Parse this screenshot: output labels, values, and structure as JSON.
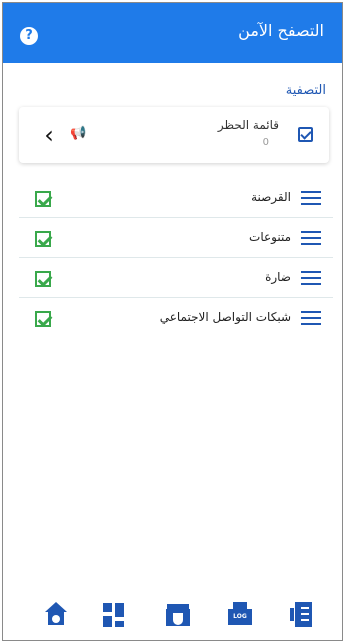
{
  "header": {
    "title": "التصفح الآمن",
    "help_icon": "help-icon"
  },
  "filtering": {
    "section_title": "التصفية",
    "blocklist": {
      "title": "قائمة الحظر",
      "count": "0",
      "checked": true,
      "icons": [
        "back-arrow-icon",
        "megaphone-icon"
      ]
    },
    "categories": [
      {
        "label": "القرصنة",
        "checked": true
      },
      {
        "label": "متنوعات",
        "checked": true
      },
      {
        "label": "ضارة",
        "checked": true
      },
      {
        "label": "شبكات التواصل الاجتماعي",
        "checked": true
      }
    ]
  },
  "bottom_nav": {
    "items": [
      "home-icon",
      "dashboard-icon",
      "shield-folder-icon",
      "log-icon",
      "settings-list-icon"
    ]
  },
  "colors": {
    "primary": "#1f7be9",
    "nav_blue": "#1f57b3",
    "check_green": "#39a84b"
  }
}
